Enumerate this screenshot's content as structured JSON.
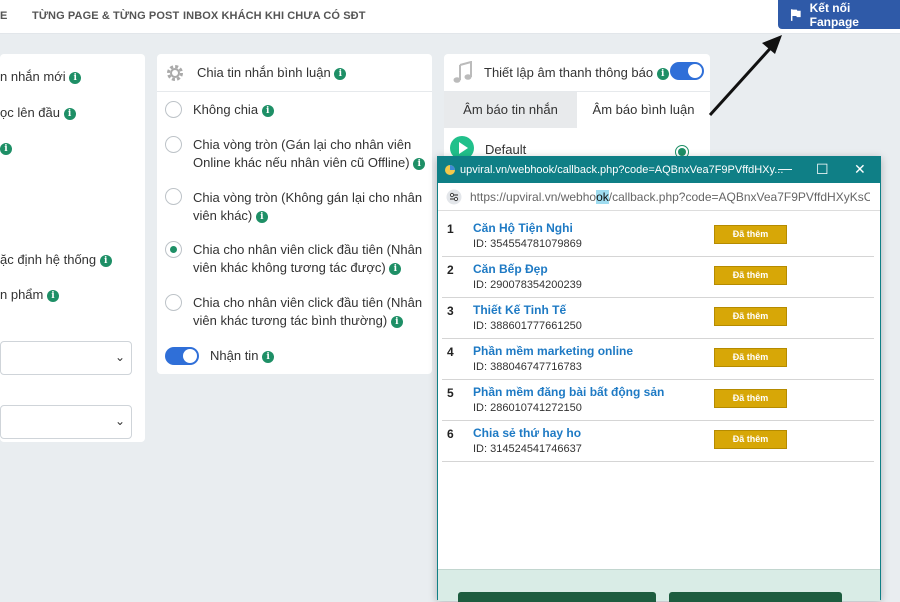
{
  "topnav": {
    "item_cut": "E",
    "item_pages": "TỪNG PAGE & TỪNG POST",
    "item_inbox": "INBOX KHÁCH KHI CHƯA CÓ SĐT",
    "connect_label": "Kết nối Fanpage"
  },
  "left_panel": {
    "items": [
      "n nhắn mới",
      "ọc lên đầu",
      "ặc định hệ thống",
      "n phẩm"
    ]
  },
  "mid_panel": {
    "title": "Chia tin nhắn bình luận",
    "options": [
      {
        "line1": "Không chia",
        "line2": "",
        "selected": false
      },
      {
        "line1": "Chia vòng tròn (Gán lại cho nhân viên",
        "line2": "Online khác nếu nhân viên cũ Offline)",
        "selected": false
      },
      {
        "line1": "Chia vòng tròn (Không gán lại cho nhân",
        "line2": "viên khác)",
        "selected": false
      },
      {
        "line1": "Chia cho nhân viên click đầu tiên (Nhân",
        "line2": "viên khác không tương tác được)",
        "selected": true
      },
      {
        "line1": "Chia cho nhân viên click đầu tiên (Nhân",
        "line2": "viên khác tương tác bình thường)",
        "selected": false
      }
    ],
    "toggle_label": "Nhận tin"
  },
  "right_panel": {
    "title": "Thiết lập âm thanh thông báo",
    "tab_message": "Âm báo tin nhắn",
    "tab_comment": "Âm báo bình luận",
    "sound_default": "Default"
  },
  "popup": {
    "window_title": "upviral.vn/webhook/callback.php?code=AQBnxVea7F9PVffdHXy...",
    "url_prefix": "https://upviral.vn/webho",
    "url_highlight": "ok",
    "url_suffix": "/callback.php?code=AQBnxVea7F9PVffdHXyKsC",
    "pages": [
      {
        "num": "1",
        "name": "Căn Hộ Tiện Nghi",
        "id": "ID: 354554781079869",
        "button": "Đã thêm"
      },
      {
        "num": "2",
        "name": "Căn Bếp Đẹp",
        "id": "ID: 290078354200239",
        "button": "Đã thêm"
      },
      {
        "num": "3",
        "name": "Thiết Kế Tinh Tế",
        "id": "ID: 388601777661250",
        "button": "Đã thêm"
      },
      {
        "num": "4",
        "name": "Phần mềm marketing online",
        "id": "ID: 388046747716783",
        "button": "Đã thêm"
      },
      {
        "num": "5",
        "name": "Phần mềm đăng bài bất động sản",
        "id": "ID: 286010741272150",
        "button": "Đã thêm"
      },
      {
        "num": "6",
        "name": "Chia sẻ thứ hay ho",
        "id": "ID: 314524541746637",
        "button": "Đã thêm"
      }
    ]
  },
  "colors": {
    "accent_green": "#1e8f66",
    "connect_blue": "#2f5aa8",
    "popup_teal": "#0f7f86",
    "added_gold": "#d7a707"
  }
}
